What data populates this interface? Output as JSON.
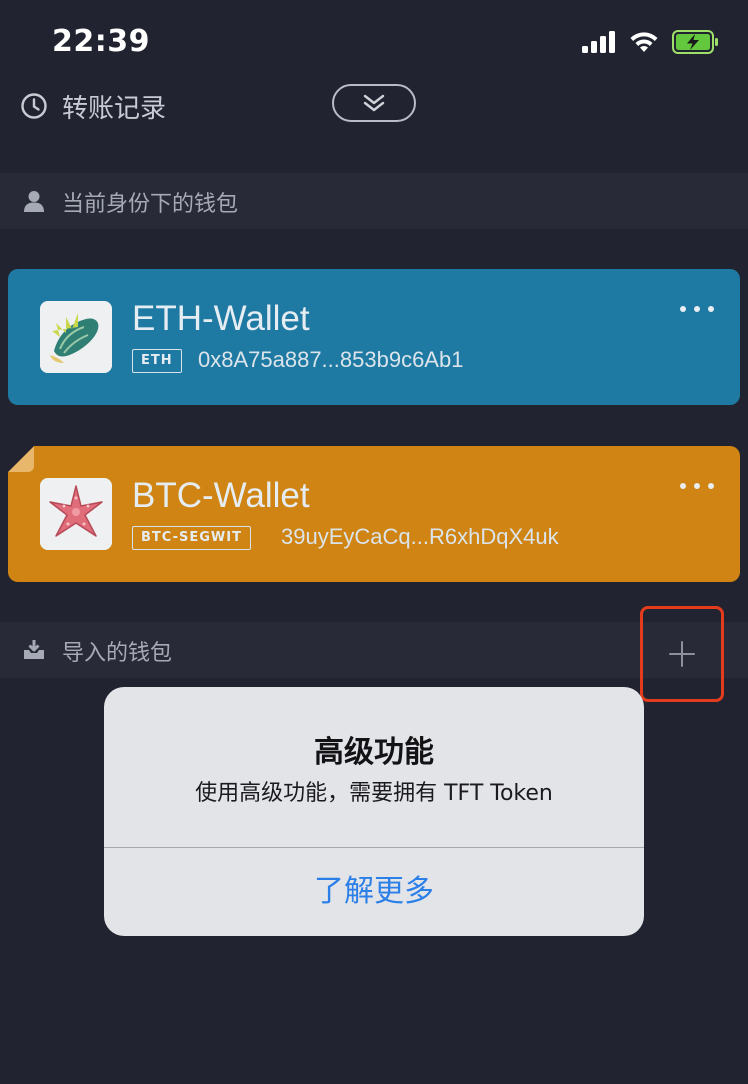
{
  "status_bar": {
    "time": "22:39",
    "icons": [
      "signal-icon",
      "wifi-icon",
      "battery-charging-icon"
    ]
  },
  "header": {
    "history_label": "转账记录",
    "history_icon": "clock-icon",
    "collapse_icon": "double-chevron-down-icon"
  },
  "identity_section": {
    "label": "当前身份下的钱包",
    "icon": "user-icon"
  },
  "wallets": [
    {
      "name": "ETH-Wallet",
      "chain": "ETH",
      "address": "0x8A75a887...853b9c6Ab1",
      "color": "#1f7aa3",
      "avatar_icon": "seashell-icon"
    },
    {
      "name": "BTC-Wallet",
      "chain": "BTC-SEGWIT",
      "address": "39uyEyCaCq...R6xhDqX4uk",
      "color": "#cf8413",
      "avatar_icon": "starfish-icon"
    }
  ],
  "imported_section": {
    "label": "导入的钱包",
    "icon": "download-box-icon",
    "add_icon": "plus-icon",
    "highlight_color": "#e23c1d"
  },
  "alert": {
    "title": "高级功能",
    "message": "使用高级功能，需要拥有 TFT Token",
    "action_label": "了解更多",
    "action_color": "#2b7fe8"
  }
}
